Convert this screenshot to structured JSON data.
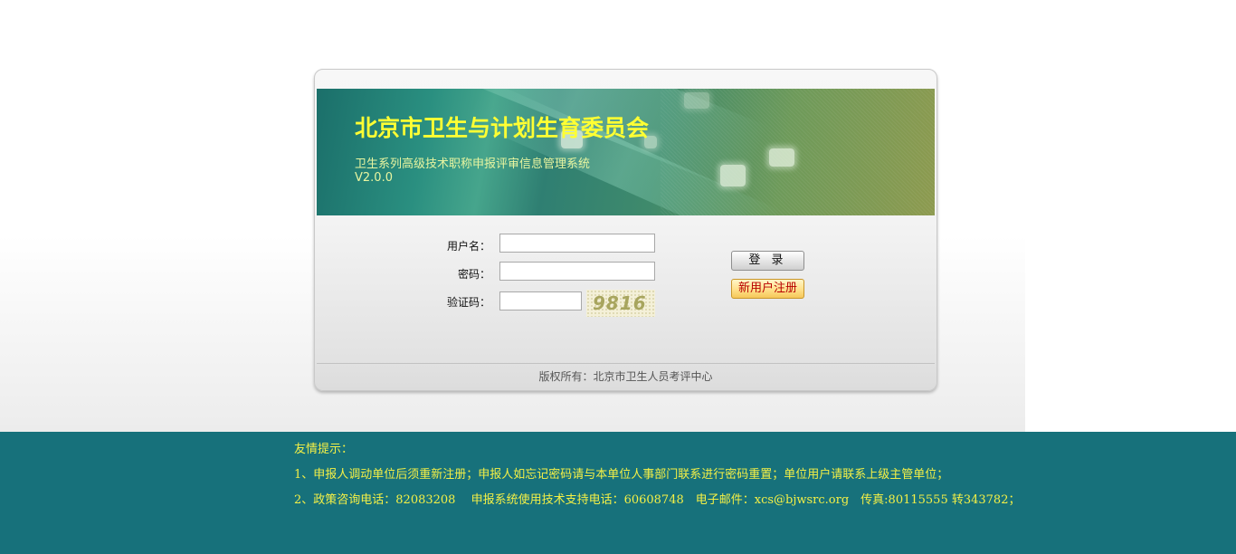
{
  "banner": {
    "title": "北京市卫生与计划生育委员会",
    "subtitle": "卫生系列高级技术职称申报评审信息管理系统",
    "version": "V2.0.0"
  },
  "form": {
    "username_label": "用户名：",
    "username_value": "",
    "password_label": "密码：",
    "password_value": "",
    "captcha_label": "验证码：",
    "captcha_value": "",
    "captcha_image_text": "9816",
    "login_button": "登 录",
    "register_button": "新用户注册"
  },
  "footer": {
    "copyright": "版权所有：北京市卫生人员考评中心"
  },
  "tips": {
    "heading": "友情提示：",
    "line1": "1、申报人调动单位后须重新注册；申报人如忘记密码请与本单位人事部门联系进行密码重置；单位用户请联系上级主管单位；",
    "line2": "2、政策咨询电话：82083208　 申报系统使用技术支持电话：60608748　电子邮件：xcs@bjwsrc.org　传真:80115555 转343782；"
  },
  "colors": {
    "tips_background": "#17717b",
    "tips_text": "#f4f046",
    "banner_title": "#ffff33",
    "register_text": "#b80000"
  }
}
